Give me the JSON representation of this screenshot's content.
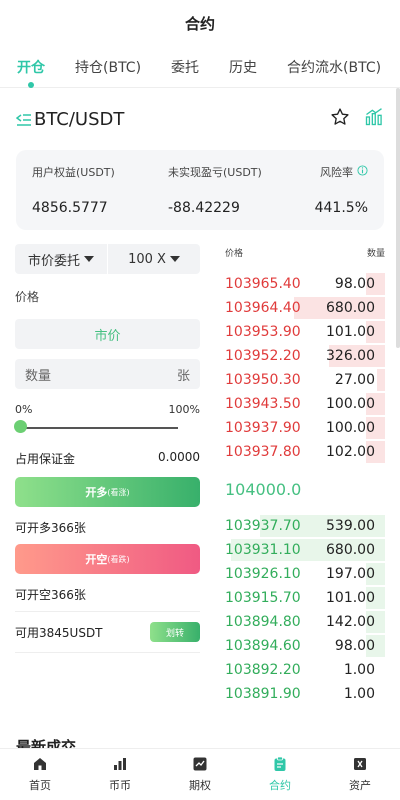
{
  "header": {
    "title": "合约"
  },
  "tabs": [
    {
      "label": "开仓"
    },
    {
      "label": "持仓(BTC)"
    },
    {
      "label": "委托"
    },
    {
      "label": "历史"
    },
    {
      "label": "合约流水(BTC)"
    }
  ],
  "symbol": {
    "name": "BTC/USDT"
  },
  "equity": {
    "labels": [
      "用户权益(USDT)",
      "未实现盈亏(USDT)",
      "风险率"
    ],
    "values": [
      "4856.5777",
      "-88.42229",
      "441.5%"
    ]
  },
  "order_form": {
    "order_type": "市价委托",
    "leverage": "100 X",
    "price_label": "价格",
    "price_value": "市价",
    "qty_placeholder": "数量",
    "qty_unit": "张",
    "pct_min": "0%",
    "pct_max": "100%",
    "slider_level": 0,
    "margin_label": "占用保证金",
    "margin_value": "0.0000",
    "long_label": "开多",
    "long_sub": "(看涨)",
    "long_available": "可开多366张",
    "short_label": "开空",
    "short_sub": "(看跌)",
    "short_available": "可开空366张",
    "available": "可用3845USDT",
    "transfer_label": "划转"
  },
  "orderbook": {
    "price_header": "价格",
    "qty_header": "数量",
    "asks": [
      {
        "price": "103965.40",
        "qty": "98.00",
        "depth": 0.12
      },
      {
        "price": "103964.40",
        "qty": "680.00",
        "depth": 0.57
      },
      {
        "price": "103953.90",
        "qty": "101.00",
        "depth": 0.12
      },
      {
        "price": "103952.20",
        "qty": "326.00",
        "depth": 0.35
      },
      {
        "price": "103950.30",
        "qty": "27.00",
        "depth": 0.05
      },
      {
        "price": "103943.50",
        "qty": "100.00",
        "depth": 0.12
      },
      {
        "price": "103937.90",
        "qty": "100.00",
        "depth": 0.12
      },
      {
        "price": "103937.80",
        "qty": "102.00",
        "depth": 0.12
      }
    ],
    "mid_price": "104000.0",
    "bids": [
      {
        "price": "103937.70",
        "qty": "539.00",
        "depth": 0.78
      },
      {
        "price": "103931.10",
        "qty": "680.00",
        "depth": 0.96
      },
      {
        "price": "103926.10",
        "qty": "197.00",
        "depth": 0.12
      },
      {
        "price": "103915.70",
        "qty": "101.00",
        "depth": 0.12
      },
      {
        "price": "103894.80",
        "qty": "142.00",
        "depth": 0.12
      },
      {
        "price": "103894.60",
        "qty": "98.00",
        "depth": 0.12
      },
      {
        "price": "103892.20",
        "qty": "1.00",
        "depth": 0.0
      },
      {
        "price": "103891.90",
        "qty": "1.00",
        "depth": 0.0
      }
    ]
  },
  "latest_trades_title": "最新成交",
  "bottom_nav": [
    {
      "label": "首页"
    },
    {
      "label": "币币"
    },
    {
      "label": "期权"
    },
    {
      "label": "合约"
    },
    {
      "label": "资产"
    }
  ],
  "colors": {
    "accent": "#2fc7a8",
    "ask": "#e03b3b",
    "bid": "#32ad5b",
    "mid": "#46c082"
  }
}
